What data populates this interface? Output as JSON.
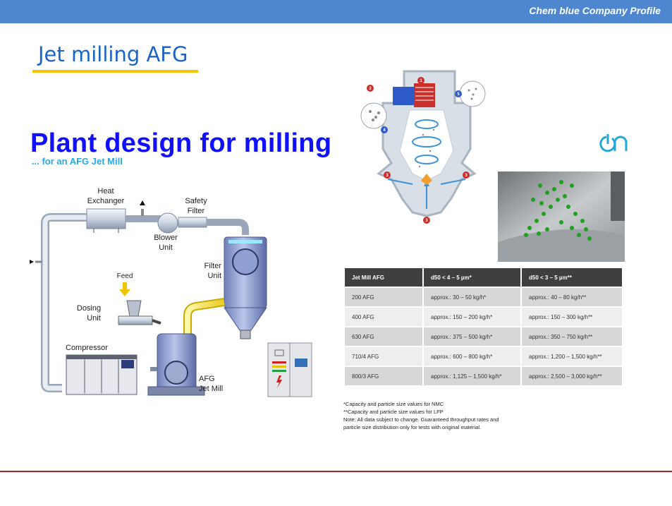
{
  "header": {
    "company": "Chem blue Company Profile"
  },
  "section_title": "Jet milling AFG",
  "plant": {
    "heading": "Plant design for milling",
    "subheading": "... for an AFG Jet Mill"
  },
  "diagram": {
    "labels": {
      "heat_exchanger_1": "Heat",
      "heat_exchanger_2": "Exchanger",
      "safety_filter_1": "Safety",
      "safety_filter_2": "Filter",
      "blower_1": "Blower",
      "blower_2": "Unit",
      "filter_unit_1": "Filter",
      "filter_unit_2": "Unit",
      "feed": "Feed",
      "dosing_1": "Dosing",
      "dosing_2": "Unit",
      "compressor": "Compressor",
      "afg_1": "AFG",
      "afg_2": "Jet Mill"
    },
    "badges": [
      "1",
      "2",
      "3",
      "3",
      "3",
      "4",
      "5"
    ]
  },
  "table": {
    "headers": [
      "Jet Mill AFG",
      "d50 < 4 – 5 µm*",
      "d50 < 3 – 5 µm**"
    ],
    "rows": [
      [
        "200 AFG",
        "approx.: 30 – 50 kg/h*",
        "approx.: 40 – 80 kg/h**"
      ],
      [
        "400 AFG",
        "approx.: 150 – 200 kg/h*",
        "approx.: 150 – 300 kg/h**"
      ],
      [
        "630 AFG",
        "approx.: 375 – 500 kg/h*",
        "approx.: 350 – 750 kg/h**"
      ],
      [
        "710/4 AFG",
        "approx.: 600 – 800 kg/h*",
        "approx.: 1,200 – 1,500 kg/h**"
      ],
      [
        "800/3 AFG",
        "approx.: 1,125 – 1,500 kg/h*",
        "approx.: 2,500 – 3,000 kg/h**"
      ]
    ]
  },
  "notes": [
    "*Capacity and particle size values for NMC",
    "**Capacity and particle size values for LFP",
    "Note: All data subject to change. Guaranteed throughput rates and",
    "particle size distribution only for tests with original material."
  ],
  "colors": {
    "header_bar": "#4f86d0",
    "title_blue": "#1a64c8",
    "underline": "#f5c400",
    "heading_blue": "#1010ff",
    "sub_cyan": "#2aa7e0",
    "logo_cyan": "#22a8d8"
  },
  "icons": [
    "cyclone-mill-diagram",
    "brand-logo-icon",
    "particle-simulation-image"
  ]
}
